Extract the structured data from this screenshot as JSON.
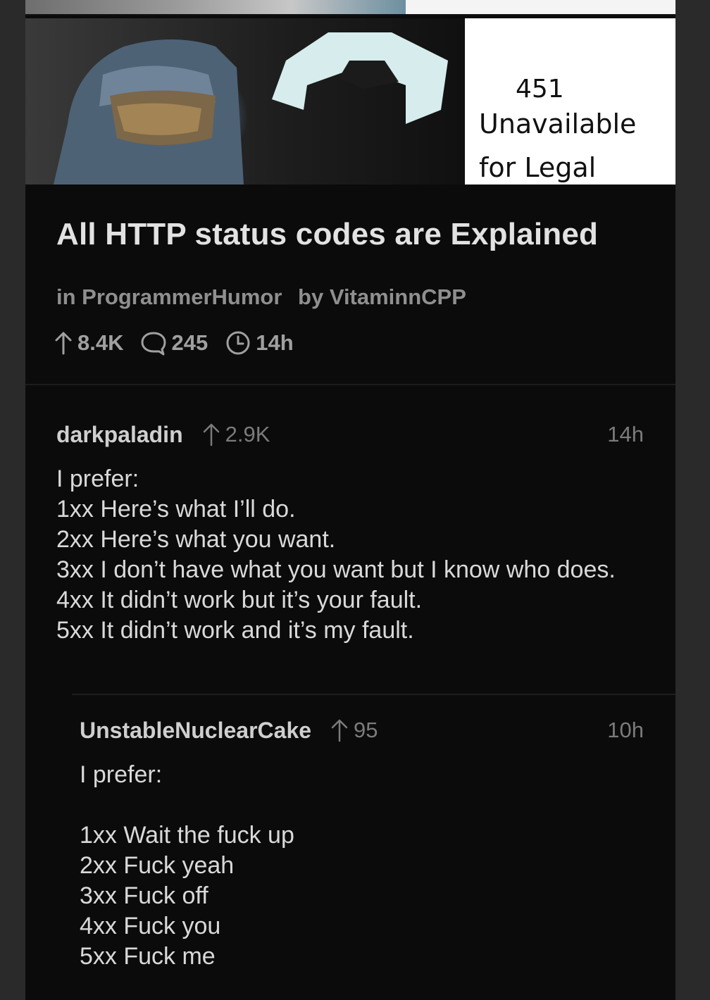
{
  "post": {
    "image": {
      "caption_code": "451",
      "caption_line1": "Unavailable",
      "caption_line2": "for Legal"
    },
    "title": "All HTTP status codes are Explained",
    "subreddit": "in ProgrammerHumor",
    "author": "by VitaminnCPP",
    "upvotes": "8.4K",
    "comments": "245",
    "age": "14h"
  },
  "comments": [
    {
      "author": "darkpaladin",
      "score": "2.9K",
      "time": "14h",
      "lines": [
        "I prefer:",
        "1xx Here’s what I’ll do.",
        "2xx Here’s what you want.",
        "3xx I don’t have what you want but I know who does.",
        "4xx It didn’t work but it’s your fault.",
        "5xx It didn’t work and it’s my fault."
      ]
    },
    {
      "author": "UnstableNuclearCake",
      "score": "95",
      "time": "10h",
      "lines": [
        "I prefer:",
        "",
        "1xx Wait the fuck up",
        "2xx Fuck yeah",
        "3xx Fuck off",
        "4xx Fuck you",
        "5xx Fuck me"
      ]
    }
  ],
  "colors": {
    "background": "#0b0b0b",
    "outer": "#2a2a2a",
    "title": "#e2e2e2",
    "meta": "#8f8f8f"
  },
  "icons": [
    "upvote-arrow-icon",
    "comment-bubble-icon",
    "clock-icon"
  ]
}
